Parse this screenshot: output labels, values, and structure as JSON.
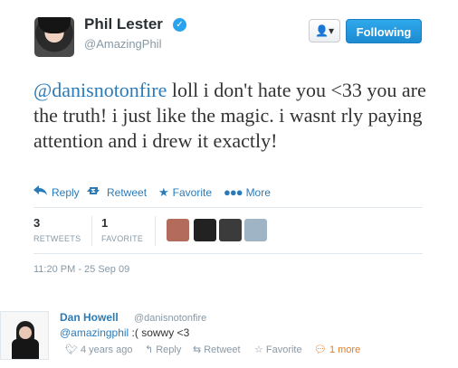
{
  "tweet": {
    "author_name": "Phil Lester",
    "author_handle": "@AmazingPhil",
    "verified_glyph": "✓",
    "text_mention": "@danisnotonfire",
    "text_body": " loll i don't hate you <33 you are the truth! i just like the magic. i wasnt rly paying attention and i drew it exactly!",
    "timestamp": "11:20 PM - 25 Sep 09"
  },
  "header_buttons": {
    "user_menu_glyph": "👤▾",
    "following_label": "Following"
  },
  "actions": {
    "reply": "Reply",
    "retweet": "Retweet",
    "favorite": "Favorite",
    "more": "More"
  },
  "stats": {
    "retweets_count": "3",
    "retweets_label": "RETWEETS",
    "favorites_count": "1",
    "favorites_label": "FAVORITE"
  },
  "favoriters": [
    {
      "name": "favoriter-avatar-1",
      "color": "#b36b5c"
    },
    {
      "name": "favoriter-avatar-2",
      "color": "#222222"
    },
    {
      "name": "favoriter-avatar-3",
      "color": "#3b3b3b"
    },
    {
      "name": "favoriter-avatar-4",
      "color": "#9fb4c4"
    }
  ],
  "reply": {
    "author_name": "Dan Howell",
    "author_handle": "@danisnotonfire",
    "text_mention": "@amazingphil",
    "text_body": " :( sowwy <3",
    "time": "4 years ago",
    "reply_label": "Reply",
    "retweet_label": "Retweet",
    "favorite_label": "Favorite",
    "more_label": "1 more"
  },
  "colors": {
    "link_blue": "#2b7bb9",
    "button_blue": "#1d8bd1",
    "muted": "#8899a6",
    "more_orange": "#e47b1d"
  }
}
